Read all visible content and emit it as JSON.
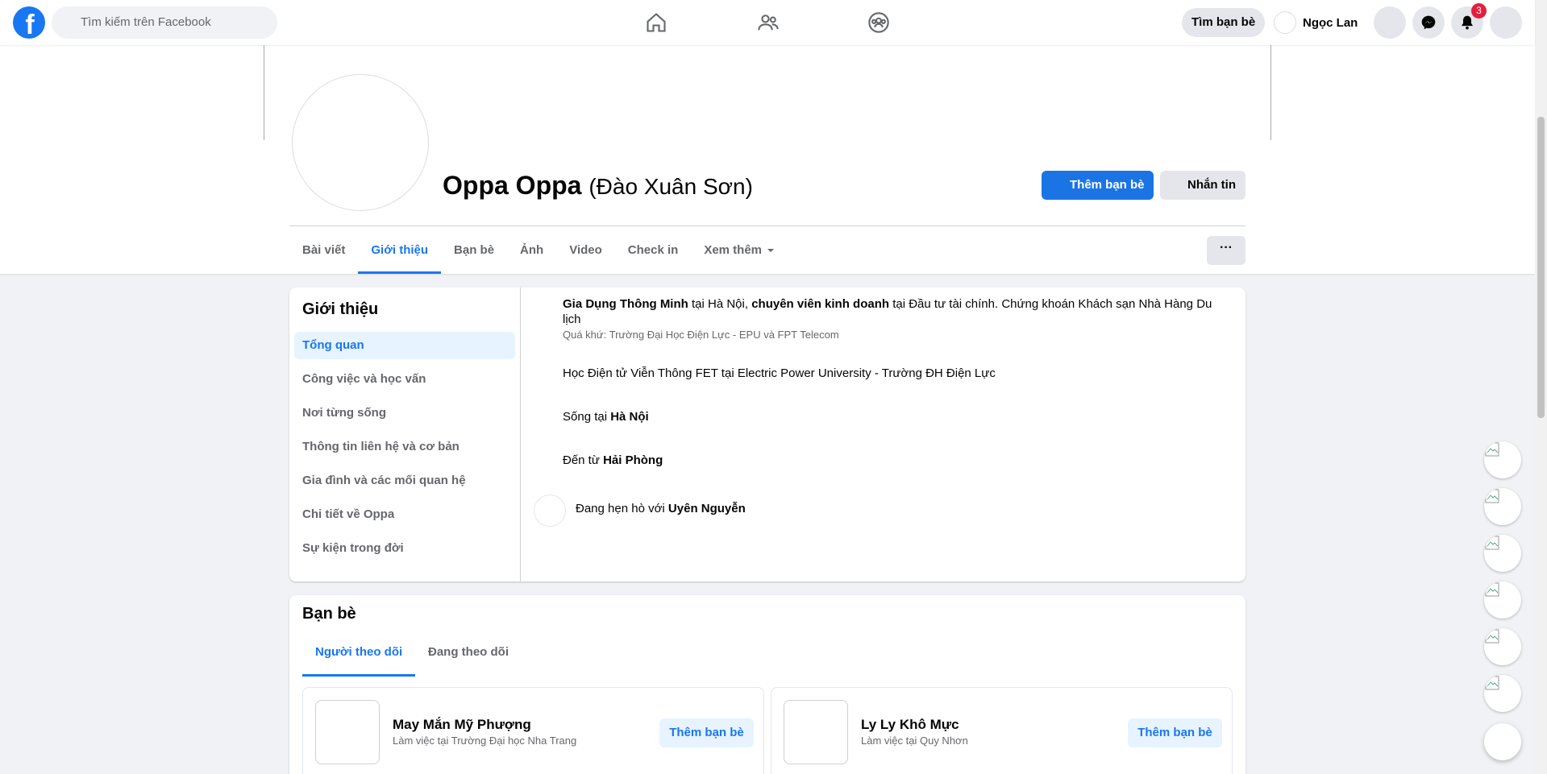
{
  "topbar": {
    "search_placeholder": "Tìm kiếm trên Facebook",
    "find_friends": "Tìm bạn bè",
    "user_name": "Ngọc Lan",
    "notifications_count": "3",
    "nav_icons": [
      "home-icon",
      "friends-icon",
      "groups-icon"
    ],
    "accent": "#1877f2"
  },
  "profile": {
    "name": "Oppa Oppa",
    "alt_name": "(Đào Xuân Sơn)",
    "add_friend": "Thêm bạn bè",
    "message": "Nhắn tin",
    "more": "···",
    "tabs": [
      "Bài viết",
      "Giới thiệu",
      "Bạn bè",
      "Ảnh",
      "Video",
      "Check in",
      "Xem thêm"
    ],
    "active_tab": "Giới thiệu"
  },
  "intro": {
    "title": "Giới thiệu",
    "sections": [
      "Tổng quan",
      "Công việc và học vấn",
      "Nơi từng sống",
      "Thông tin liên hệ và cơ bản",
      "Gia đình và các mối quan hệ",
      "Chi tiết về Oppa",
      "Sự kiện trong đời"
    ],
    "work": {
      "company": "Gia Dụng Thông Minh",
      "at1": "tại Hà Nội,",
      "role": "chuyên viên kinh doanh",
      "at2": "tại Đầu tư tài chính. Chứng khoán Khách sạn Nhà Hàng Du lịch",
      "past": "Quá khứ: Trường Đại Học Điện Lực - EPU và FPT Telecom"
    },
    "study": "Học Điện tử Viễn Thông FET tại Electric Power University - Trường ĐH Điện Lực",
    "lives_prefix": "Sống tại",
    "lives_city": "Hà Nội",
    "from_prefix": "Đến từ",
    "from_city": "Hải Phòng",
    "dating_prefix": "Đang hẹn hò với",
    "dating_name": "Uyên Nguyễn"
  },
  "friends": {
    "title": "Bạn bè",
    "tabs": [
      "Người theo dõi",
      "Đang theo dõi"
    ],
    "items": [
      {
        "name": "May Mắn Mỹ Phượng",
        "sub": "Làm việc tại Trường Đại học Nha Trang",
        "button": "Thêm bạn bè"
      },
      {
        "name": "Ly Ly Khô Mực",
        "sub": "Làm việc tại Quy Nhơn",
        "button": "Thêm bạn bè"
      }
    ]
  }
}
